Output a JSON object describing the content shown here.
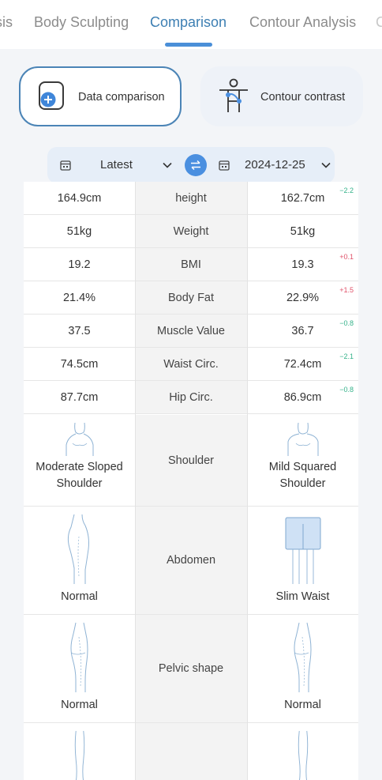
{
  "tabs": [
    {
      "label": "sis",
      "active": false
    },
    {
      "label": "Body Sculpting",
      "active": false
    },
    {
      "label": "Comparison",
      "active": true
    },
    {
      "label": "Contour Analysis",
      "active": false
    }
  ],
  "modes": {
    "data_comparison": "Data comparison",
    "contour_contrast": "Contour contrast"
  },
  "date_selector": {
    "left_value": "Latest",
    "right_value": "2024-12-25"
  },
  "metrics": [
    {
      "name": "height",
      "left": "164.9cm",
      "right": "162.7cm",
      "delta": "−2.2",
      "trend": "down"
    },
    {
      "name": "Weight",
      "left": "51kg",
      "right": "51kg",
      "delta": "",
      "trend": ""
    },
    {
      "name": "BMI",
      "left": "19.2",
      "right": "19.3",
      "delta": "+0.1",
      "trend": "up"
    },
    {
      "name": "Body Fat",
      "left": "21.4%",
      "right": "22.9%",
      "delta": "+1.5",
      "trend": "up"
    },
    {
      "name": "Muscle Value",
      "left": "37.5",
      "right": "36.7",
      "delta": "−0.8",
      "trend": "down"
    },
    {
      "name": "Waist Circ.",
      "left": "74.5cm",
      "right": "72.4cm",
      "delta": "−2.1",
      "trend": "down"
    },
    {
      "name": "Hip Circ.",
      "left": "87.7cm",
      "right": "86.9cm",
      "delta": "−0.8",
      "trend": "down"
    }
  ],
  "shapes": [
    {
      "name": "Shoulder",
      "left": "Moderate Sloped Shoulder",
      "right": "Mild Squared Shoulder"
    },
    {
      "name": "Abdomen",
      "left": "Normal",
      "right": "Slim Waist"
    },
    {
      "name": "Pelvic shape",
      "left": "Normal",
      "right": "Normal"
    }
  ],
  "colors": {
    "accent": "#4a8fd8",
    "delta_down": "#35b28a",
    "delta_up": "#e0526a"
  },
  "icons": [
    "plus-circle-icon",
    "body-figure-icon",
    "calendar-icon",
    "chevron-down-icon",
    "swap-icon"
  ]
}
